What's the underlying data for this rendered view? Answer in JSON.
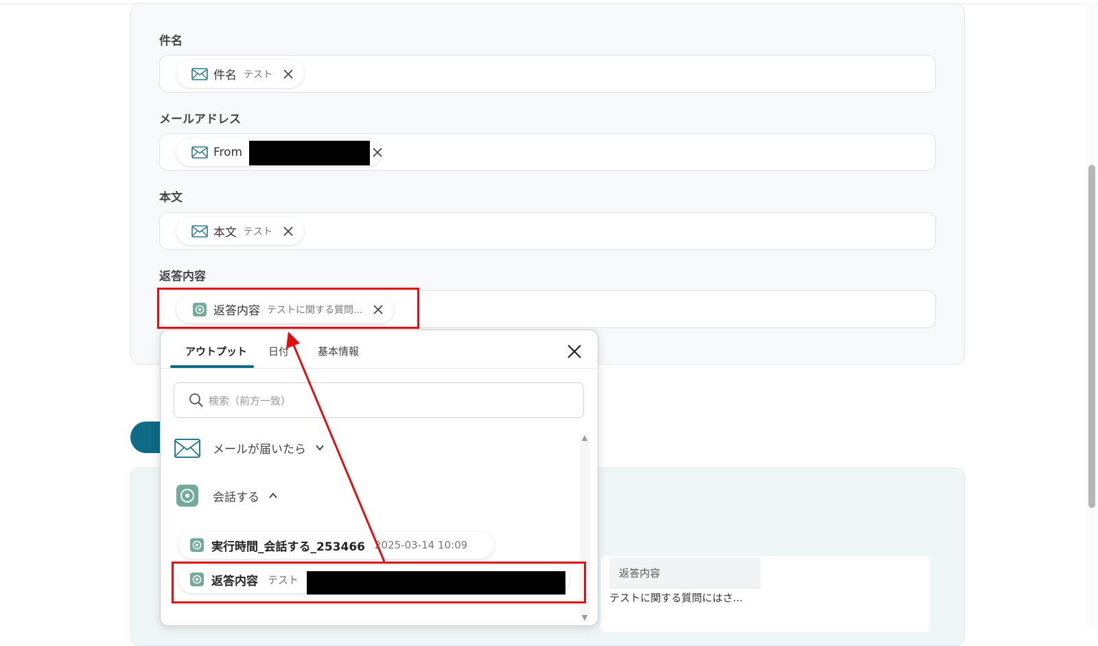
{
  "form": {
    "fields": [
      {
        "label": "件名",
        "chip_name": "件名",
        "chip_value": "テスト",
        "icon": "mail-icon"
      },
      {
        "label": "メールアドレス",
        "chip_name": "From",
        "chip_value": "",
        "icon": "mail-icon"
      },
      {
        "label": "本文",
        "chip_name": "本文",
        "chip_value": "テスト",
        "icon": "mail-icon"
      },
      {
        "label": "返答内容",
        "chip_name": "返答内容",
        "chip_value": "テストに関する質問...",
        "icon": "chatgpt-icon"
      }
    ]
  },
  "popup": {
    "tabs": [
      "アウトプット",
      "日付",
      "基本情報"
    ],
    "active_tab": "アウトプット",
    "search_placeholder": "検索（前方一致）",
    "groups": [
      {
        "label": "メールが届いたら",
        "icon": "mail-icon",
        "expanded": false
      },
      {
        "label": "会話する",
        "icon": "chatgpt-icon",
        "expanded": true
      }
    ],
    "items": [
      {
        "name": "実行時間_会話する_253466",
        "value": "2025-03-14 10:09"
      },
      {
        "name": "返答内容",
        "value": "テスト"
      }
    ]
  },
  "table": {
    "header": "返答内容",
    "cell": "テストに関する質問にはさ..."
  },
  "colors": {
    "accent": "#0e6a85",
    "annotation_red": "#e01010",
    "chatgpt_green": "#74aa9c"
  }
}
